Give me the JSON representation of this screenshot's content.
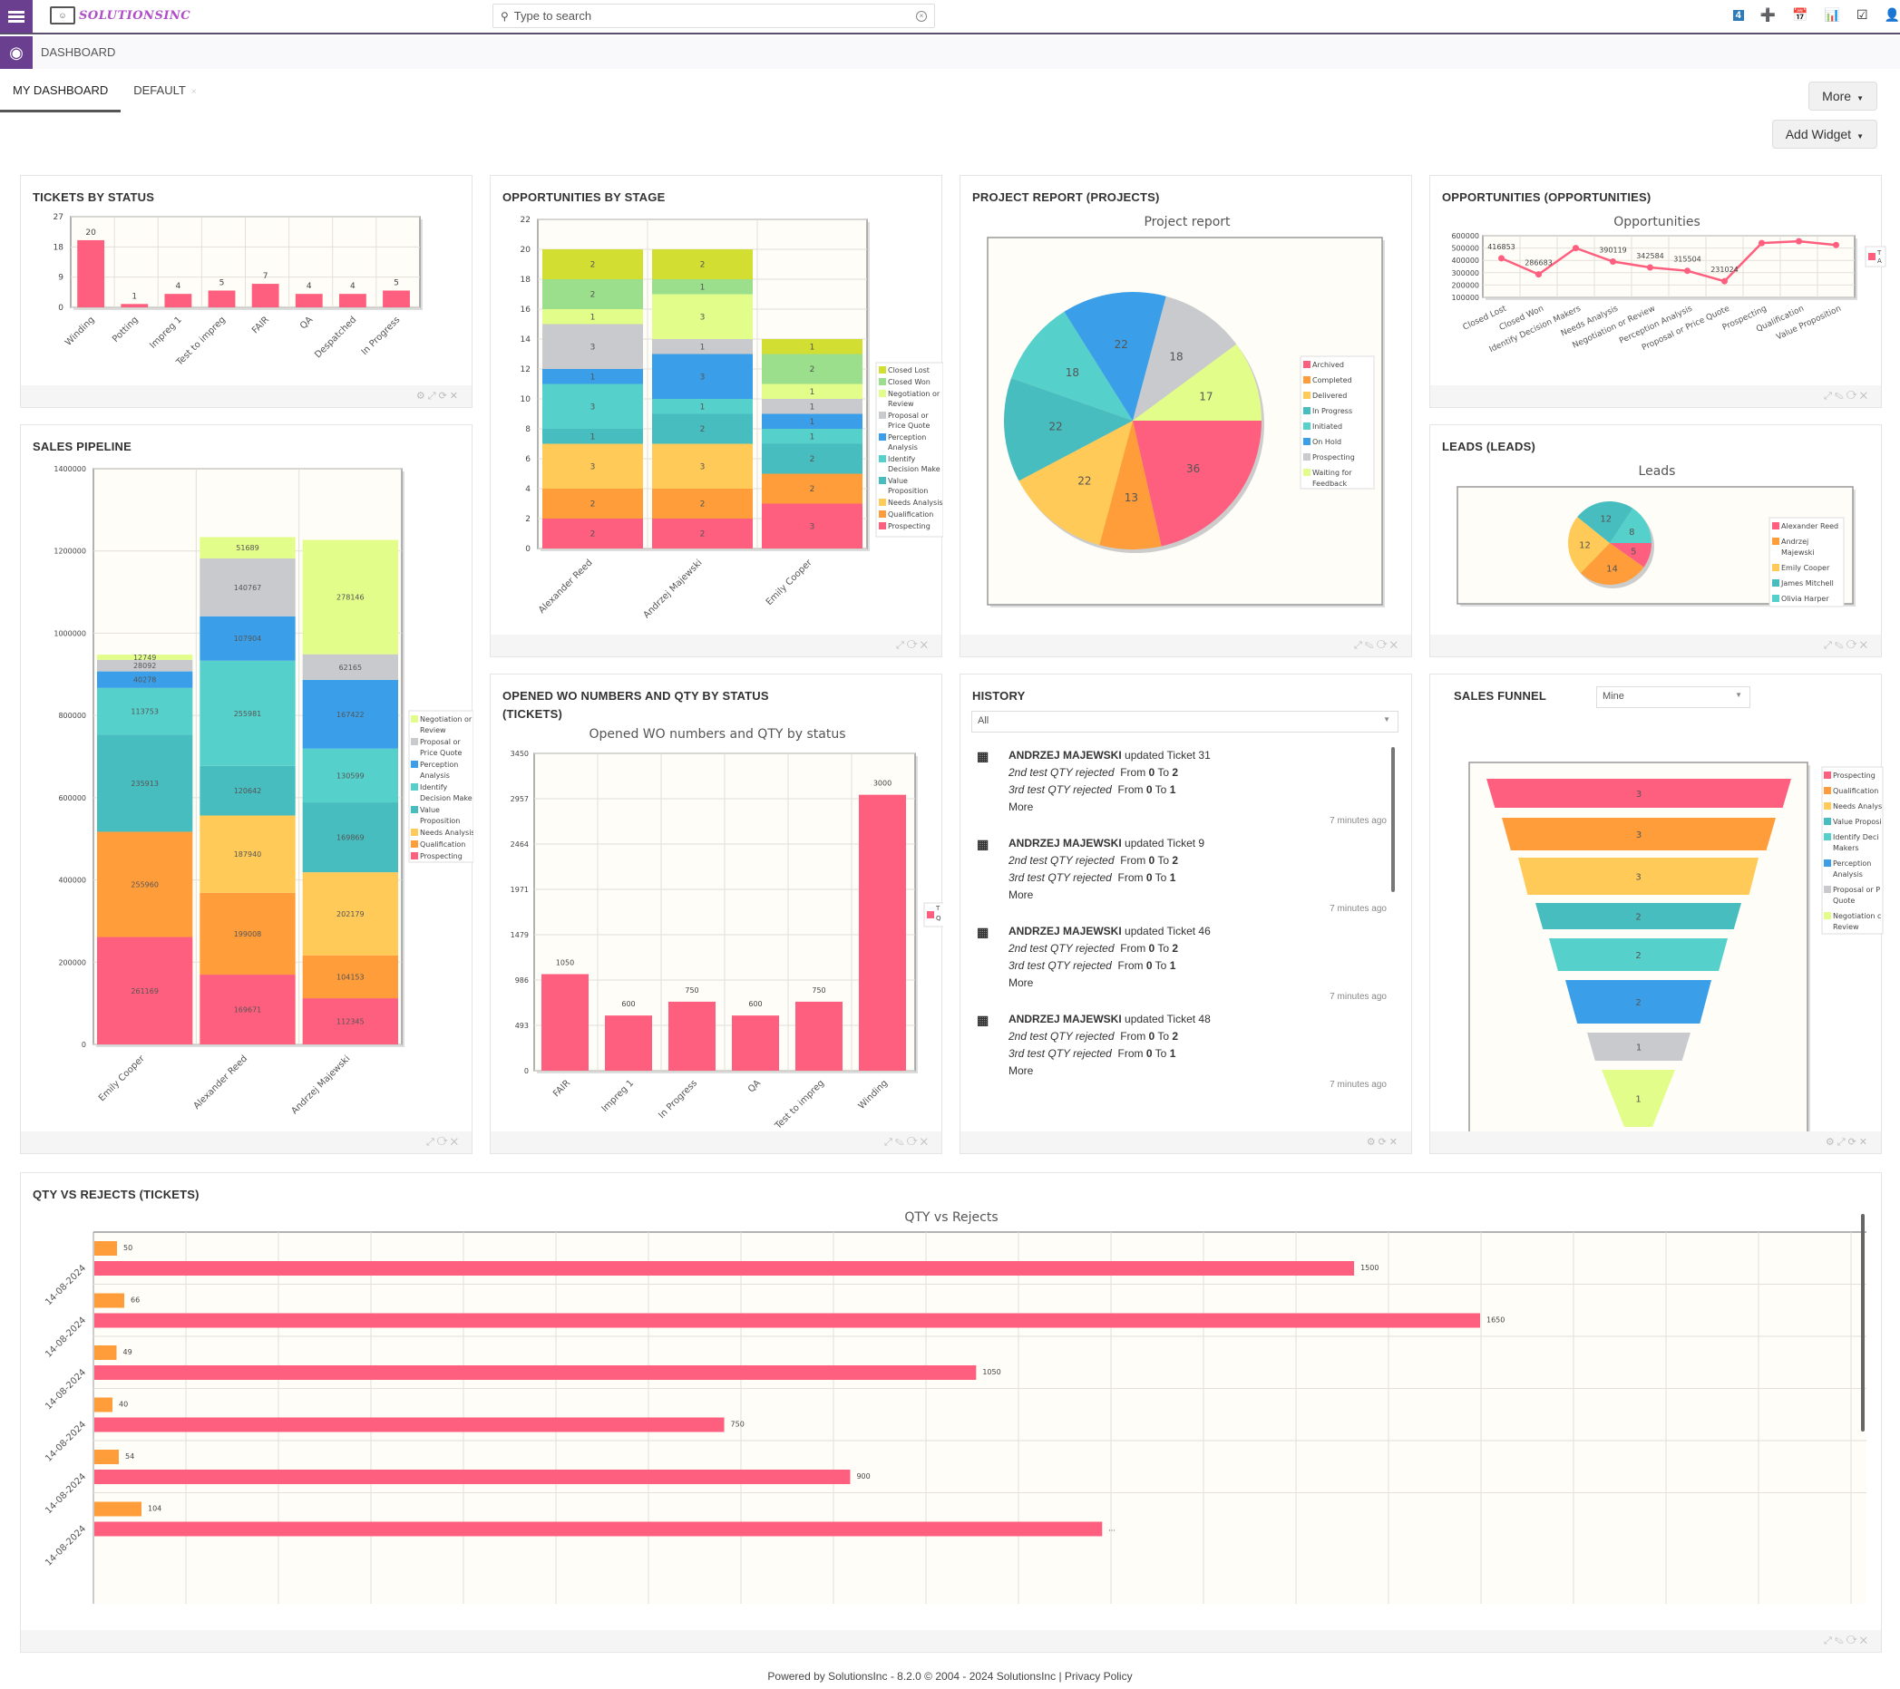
{
  "app": {
    "logo_text": "SOLUTIONSINC",
    "search_placeholder": "Type to search",
    "notification_count": "4"
  },
  "breadcrumb": "DASHBOARD",
  "tabs": [
    {
      "label": "MY DASHBOARD",
      "active": true
    },
    {
      "label": "DEFAULT",
      "active": false
    }
  ],
  "buttons": {
    "more": "More",
    "add_widget": "Add Widget"
  },
  "widgets": {
    "tickets_by_status": {
      "title": "TICKETS BY STATUS"
    },
    "opportunities_by_stage": {
      "title": "OPPORTUNITIES BY STAGE"
    },
    "project_report": {
      "title": "PROJECT REPORT (PROJECTS)"
    },
    "opportunities": {
      "title": "OPPORTUNITIES (OPPORTUNITIES)"
    },
    "sales_pipeline": {
      "title": "SALES PIPELINE"
    },
    "leads": {
      "title": "LEADS (LEADS)"
    },
    "opened_wo": {
      "title_line1": "OPENED WO NUMBERS AND QTY BY STATUS",
      "title_line2": "(TICKETS)"
    },
    "history": {
      "title": "HISTORY",
      "filter": "All",
      "items": [
        {
          "user": "ANDRZEJ MAJEWSKI",
          "action": "updated Ticket 31",
          "change1_field": "2nd test QTY rejected",
          "change1_from": "0",
          "change1_to": "2",
          "change2_field": "3rd test QTY rejected",
          "change2_from": "0",
          "change2_to": "1",
          "more": "More",
          "time": "7 minutes ago"
        },
        {
          "user": "ANDRZEJ MAJEWSKI",
          "action": "updated Ticket 9",
          "change1_field": "2nd test QTY rejected",
          "change1_from": "0",
          "change1_to": "2",
          "change2_field": "3rd test QTY rejected",
          "change2_from": "0",
          "change2_to": "1",
          "more": "More",
          "time": "7 minutes ago"
        },
        {
          "user": "ANDRZEJ MAJEWSKI",
          "action": "updated Ticket 46",
          "change1_field": "2nd test QTY rejected",
          "change1_from": "0",
          "change1_to": "2",
          "change2_field": "3rd test QTY rejected",
          "change2_from": "0",
          "change2_to": "1",
          "more": "More",
          "time": "7 minutes ago"
        },
        {
          "user": "ANDRZEJ MAJEWSKI",
          "action": "updated Ticket 48",
          "change1_field": "2nd test QTY rejected",
          "change1_from": "0",
          "change1_to": "2",
          "change2_field": "3rd test QTY rejected",
          "change2_from": "0",
          "change2_to": "1",
          "more": "More",
          "time": "7 minutes ago"
        }
      ],
      "labels": {
        "from": "From",
        "to": "To"
      }
    },
    "sales_funnel": {
      "title": "SALES FUNNEL",
      "filter": "Mine"
    },
    "qty_vs_rejects": {
      "title": "QTY VS REJECTS (TICKETS)"
    }
  },
  "colors": {
    "pink": "#fe5f7e",
    "orange": "#fe9d3a",
    "yellow": "#ffca57",
    "teal": "#48bdbf",
    "cyan": "#56d0cb",
    "blue": "#3a9fe8",
    "grey": "#c9cacd",
    "lime": "#e2fd8a",
    "green": "#9bdf8d",
    "olive": "#d3de33",
    "accent": "#6b3f8f"
  },
  "chart_data": [
    {
      "id": "tickets_by_status",
      "type": "bar",
      "title": "",
      "categories": [
        "Winding",
        "Potting",
        "Impreg 1",
        "Test to impreg",
        "FAIR",
        "QA",
        "Despatched",
        "In Progress"
      ],
      "values": [
        20,
        1,
        4,
        5,
        7,
        4,
        4,
        5
      ],
      "yticks": [
        0,
        9,
        18,
        27
      ],
      "ylim": [
        0,
        27
      ]
    },
    {
      "id": "opportunities_by_stage",
      "type": "bar",
      "stacked": true,
      "title": "",
      "categories": [
        "Alexander Reed",
        "Andrzej Majewski",
        "Emily Cooper"
      ],
      "series": [
        {
          "name": "Prospecting",
          "color": "#fe5f7e",
          "values": [
            2,
            2,
            3
          ]
        },
        {
          "name": "Qualification",
          "color": "#fe9d3a",
          "values": [
            2,
            2,
            2
          ]
        },
        {
          "name": "Needs Analysis",
          "color": "#ffca57",
          "values": [
            3,
            3,
            0
          ]
        },
        {
          "name": "Value Proposition",
          "color": "#48bdbf",
          "values": [
            1,
            2,
            2
          ]
        },
        {
          "name": "Identify Decision Makers",
          "color": "#56d0cb",
          "values": [
            3,
            1,
            1
          ]
        },
        {
          "name": "Perception Analysis",
          "color": "#3a9fe8",
          "values": [
            1,
            3,
            1
          ]
        },
        {
          "name": "Proposal or Price Quote",
          "color": "#c9cacd",
          "values": [
            3,
            1,
            1
          ]
        },
        {
          "name": "Negotiation or Review",
          "color": "#e2fd8a",
          "values": [
            1,
            3,
            1
          ]
        },
        {
          "name": "Closed Won",
          "color": "#9bdf8d",
          "values": [
            2,
            1,
            2
          ]
        },
        {
          "name": "Closed Lost",
          "color": "#d3de33",
          "values": [
            2,
            2,
            1
          ]
        }
      ],
      "legend": [
        "Closed Lost",
        "Closed Won",
        "Negotiation or Review",
        "Proposal or Price Quote",
        "Perception Analysis",
        "Identify Decision Make",
        "Value Proposition",
        "Needs Analysis",
        "Qualification",
        "Prospecting"
      ],
      "yticks": [
        0,
        2,
        4,
        6,
        8,
        10,
        12,
        14,
        16,
        18,
        20,
        22
      ],
      "ylim": [
        0,
        22
      ]
    },
    {
      "id": "project_report",
      "type": "pie",
      "title": "Project report",
      "slices": [
        {
          "label": "Archived",
          "value": 36,
          "color": "#fe5f7e"
        },
        {
          "label": "Completed",
          "value": 13,
          "color": "#fe9d3a"
        },
        {
          "label": "Delivered",
          "value": 22,
          "color": "#ffca57"
        },
        {
          "label": "In Progress",
          "value": 22,
          "color": "#48bdbf"
        },
        {
          "label": "Initiated",
          "value": 18,
          "color": "#56d0cb"
        },
        {
          "label": "On Hold",
          "value": 22,
          "color": "#3a9fe8"
        },
        {
          "label": "Prospecting",
          "value": 18,
          "color": "#c9cacd"
        },
        {
          "label": "Waiting for Feedback",
          "value": 17,
          "color": "#e2fd8a"
        }
      ]
    },
    {
      "id": "opportunities",
      "type": "line",
      "title": "Opportunities",
      "categories": [
        "Closed Lost",
        "Closed Won",
        "Identify Decision Makers",
        "Needs Analysis",
        "Negotiation or Review",
        "Perception Analysis",
        "Proposal or Price Quote",
        "Prospecting",
        "Qualification",
        "Value Proposition"
      ],
      "values": [
        416853,
        286683,
        500000,
        390119,
        342584,
        315504,
        231024,
        540000,
        555000,
        525000
      ],
      "labels": [
        "416853",
        "286683",
        "",
        "390119",
        "342584",
        "315504",
        "231024",
        "",
        "",
        ""
      ],
      "yticks": [
        100000,
        200000,
        300000,
        400000,
        500000,
        600000
      ],
      "ylim": [
        100000,
        600000
      ],
      "legend": [
        "T A"
      ]
    },
    {
      "id": "sales_pipeline",
      "type": "bar",
      "stacked": true,
      "title": "",
      "categories": [
        "Emily Cooper",
        "Alexander Reed",
        "Andrzej Majewski"
      ],
      "series": [
        {
          "name": "Prospecting",
          "color": "#fe5f7e",
          "values": [
            261169,
            169671,
            112345
          ]
        },
        {
          "name": "Qualification",
          "color": "#fe9d3a",
          "values": [
            255960,
            199008,
            104153
          ]
        },
        {
          "name": "Needs Analysis",
          "color": "#ffca57",
          "values": [
            0,
            187940,
            202179
          ]
        },
        {
          "name": "Value Proposition",
          "color": "#48bdbf",
          "values": [
            235913,
            120642,
            169869
          ]
        },
        {
          "name": "Identify Decision Makers",
          "color": "#56d0cb",
          "values": [
            113753,
            255981,
            130599
          ]
        },
        {
          "name": "Perception Analysis",
          "color": "#3a9fe8",
          "values": [
            40278,
            107904,
            167422
          ]
        },
        {
          "name": "Proposal or Price Quote",
          "color": "#c9cacd",
          "values": [
            28092,
            140767,
            62165
          ]
        },
        {
          "name": "Negotiation or Review",
          "color": "#e2fd8a",
          "values": [
            12749,
            51689,
            278146
          ]
        }
      ],
      "legend": [
        "Negotiation or Review",
        "Proposal or Price Quote",
        "Perception Analysis",
        "Identify Decision Make",
        "Value Proposition",
        "Needs Analysis",
        "Qualification",
        "Prospecting"
      ],
      "yticks": [
        0,
        200000,
        400000,
        600000,
        800000,
        1000000,
        1200000,
        1400000
      ],
      "ylim": [
        0,
        1400000
      ]
    },
    {
      "id": "leads",
      "type": "pie",
      "title": "Leads",
      "slices": [
        {
          "label": "Alexander Reed",
          "value": 5,
          "color": "#fe5f7e"
        },
        {
          "label": "Andrzej Majewski",
          "value": 14,
          "color": "#fe9d3a"
        },
        {
          "label": "Emily Cooper",
          "value": 12,
          "color": "#ffca57"
        },
        {
          "label": "James Mitchell",
          "value": 12,
          "color": "#48bdbf"
        },
        {
          "label": "Olivia Harper",
          "value": 8,
          "color": "#56d0cb"
        }
      ]
    },
    {
      "id": "opened_wo",
      "type": "bar",
      "title": "Opened WO numbers and QTY by status",
      "categories": [
        "FAIR",
        "Impreg 1",
        "In Progress",
        "QA",
        "Test to impreg",
        "Winding"
      ],
      "values": [
        1050,
        600,
        750,
        600,
        750,
        3000
      ],
      "yticks": [
        0,
        493,
        986,
        1479,
        1971,
        2464,
        2957,
        3450
      ],
      "ylim": [
        0,
        3450
      ],
      "legend": [
        "T Q"
      ]
    },
    {
      "id": "sales_funnel",
      "type": "bar",
      "subtype": "funnel",
      "title": "",
      "categories": [
        "Prospecting",
        "Qualification",
        "Needs Analysis",
        "Value Proposition",
        "Identify Decision Makers",
        "Perception Analysis",
        "Proposal or Price Quote",
        "Negotiation or Review"
      ],
      "values": [
        3,
        3,
        3,
        2,
        2,
        2,
        1,
        1
      ],
      "colors": [
        "#fe5f7e",
        "#fe9d3a",
        "#ffca57",
        "#48bdbf",
        "#56d0cb",
        "#3a9fe8",
        "#c9cacd",
        "#e2fd8a"
      ],
      "legend": [
        "Prospecting",
        "Qualification",
        "Needs Analys",
        "Value Proposi",
        "Identify Deci Makers",
        "Perception Analysis",
        "Proposal or P Quote",
        "Negotiation c Review"
      ]
    },
    {
      "id": "qty_vs_rejects",
      "type": "bar",
      "orientation": "horizontal",
      "title": "QTY vs Rejects",
      "categories": [
        "14-08-2024",
        "14-08-2024",
        "14-08-2024",
        "14-08-2024",
        "14-08-2024",
        "14-08-2024"
      ],
      "series": [
        {
          "name": "Rejects",
          "color": "#fe9d3a",
          "values": [
            50,
            66,
            49,
            40,
            54,
            104
          ]
        },
        {
          "name": "QTY",
          "color": "#fe5f7e",
          "values": [
            1500,
            1650,
            1050,
            750,
            900,
            1200
          ]
        }
      ],
      "qty_labels": [
        "1500",
        "1650",
        "1050",
        "750",
        "900",
        "..."
      ],
      "xlim": [
        0,
        1900
      ]
    }
  ],
  "footer": {
    "text": "Powered by SolutionsInc - 8.2.0  © 2004 - 2024  SolutionsInc |",
    "privacy": "Privacy Policy"
  }
}
